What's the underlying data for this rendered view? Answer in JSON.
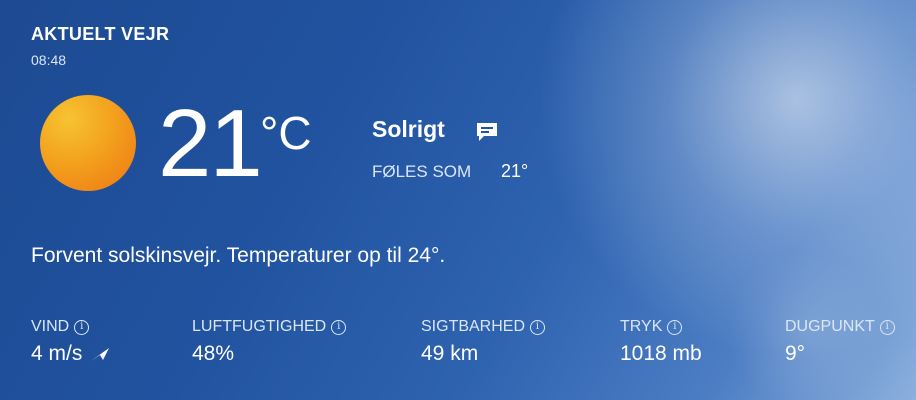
{
  "header": {
    "title": "AKTUELT VEJR",
    "time": "08:48"
  },
  "current": {
    "temperature": "21",
    "unit": "°C",
    "condition": "Solrigt",
    "feels_like_label": "FØLES SOM",
    "feels_like_value": "21°",
    "icon": "sun-icon",
    "condition_action_icon": "chat-icon"
  },
  "forecast_text": "Forvent solskinsvejr. Temperaturer op til 24°.",
  "metrics": [
    {
      "label": "VIND",
      "value": "4 m/s",
      "icon": "info-icon",
      "extra_icon": "wind-direction-icon"
    },
    {
      "label": "LUFTFUGTIGHED",
      "value": "48%",
      "icon": "info-icon"
    },
    {
      "label": "SIGTBARHED",
      "value": "49 km",
      "icon": "info-icon"
    },
    {
      "label": "TRYK",
      "value": "1018 mb",
      "icon": "info-icon"
    },
    {
      "label": "DUGPUNKT",
      "value": "9°",
      "icon": "info-icon"
    }
  ],
  "colors": {
    "background_start": "#1d4a92",
    "background_end": "#8cb0dd",
    "sun_yellow": "#f6c431",
    "sun_orange": "#ee7612",
    "text": "#ffffff",
    "muted_text": "#dbe6f5"
  }
}
